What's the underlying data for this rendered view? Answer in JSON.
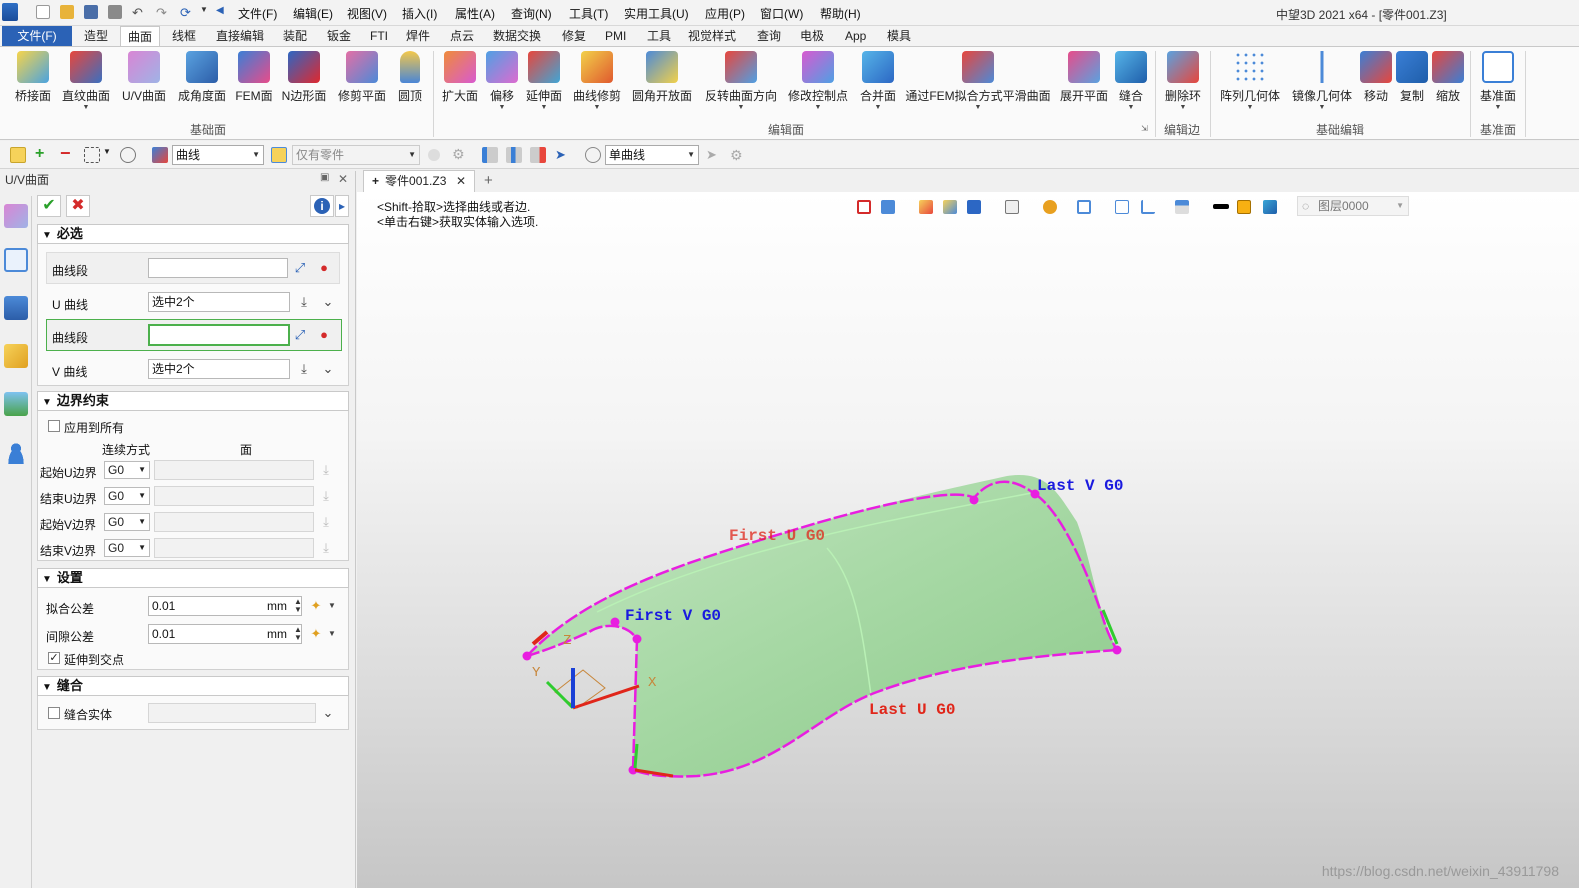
{
  "menubar": {
    "items": [
      "文件(F)",
      "编辑(E)",
      "视图(V)",
      "插入(I)",
      "属性(A)",
      "查询(N)",
      "工具(T)",
      "实用工具(U)",
      "应用(P)",
      "窗口(W)",
      "帮助(H)"
    ],
    "window_title": "中望3D 2021 x64 - [零件001.Z3]"
  },
  "ribbon_tabs": [
    "文件(F)",
    "造型",
    "曲面",
    "线框",
    "直接编辑",
    "装配",
    "钣金",
    "FTI",
    "焊件",
    "点云",
    "数据交换",
    "修复",
    "PMI",
    "工具",
    "视觉样式",
    "查询",
    "电极",
    "App",
    "模具"
  ],
  "ribbon": {
    "buttons": [
      "桥接面",
      "直纹曲面",
      "U/V曲面",
      "成角度面",
      "FEM面",
      "N边形面",
      "修剪平面",
      "圆顶",
      "扩大面",
      "偏移",
      "延伸面",
      "曲线修剪",
      "圆角开放面",
      "反转曲面方向",
      "修改控制点",
      "合并面",
      "通过FEM拟合方式平滑曲面",
      "展开平面",
      "缝合",
      "删除环",
      "阵列几何体",
      "镜像几何体",
      "移动",
      "复制",
      "缩放",
      "基准面"
    ],
    "groups": [
      "基础面",
      "编辑面",
      "编辑边",
      "基础编辑",
      "基准面"
    ]
  },
  "toolbar": {
    "filter_value": "曲线",
    "scope_value": "仅有零件",
    "pick_mode_value": "单曲线"
  },
  "panel": {
    "title": "U/V曲面",
    "required": {
      "header": "必选",
      "seg1_label": "曲线段",
      "u_label": "U 曲线",
      "u_value": "选中2个",
      "seg2_label": "曲线段",
      "v_label": "V 曲线",
      "v_value": "选中2个"
    },
    "boundary": {
      "header": "边界约束",
      "apply_all": "应用到所有",
      "col_continuity": "连续方式",
      "col_face": "面",
      "rows": [
        {
          "label": "起始U边界",
          "value": "G0"
        },
        {
          "label": "结束U边界",
          "value": "G0"
        },
        {
          "label": "起始V边界",
          "value": "G0"
        },
        {
          "label": "结束V边界",
          "value": "G0"
        }
      ]
    },
    "settings": {
      "header": "设置",
      "fit_label": "拟合公差",
      "fit_value": "0.01",
      "gap_label": "间隙公差",
      "gap_value": "0.01",
      "unit": "mm",
      "extend_label": "延伸到交点",
      "extend_checked": true
    },
    "stitch": {
      "header": "缝合",
      "solid_label": "缝合实体"
    }
  },
  "doc": {
    "tab_label": "零件001.Z3"
  },
  "viewport": {
    "prompt1": "<Shift-拾取>选择曲线或者边.",
    "prompt2": "<单击右键>获取实体输入选项.",
    "layer": "图层0000",
    "annotations": {
      "last_v": "Last V G0",
      "first_u": "First U G0",
      "first_v": "First V G0",
      "last_u": "Last U G0"
    },
    "axes": {
      "x": "X",
      "y": "Y",
      "z": "Z"
    },
    "colors": {
      "surface": "#a6d8a4",
      "boundary": "#e81ee0",
      "v_label": "#1a1adf",
      "u_label": "#e0261a"
    }
  },
  "watermark": "https://blog.csdn.net/weixin_43911798"
}
